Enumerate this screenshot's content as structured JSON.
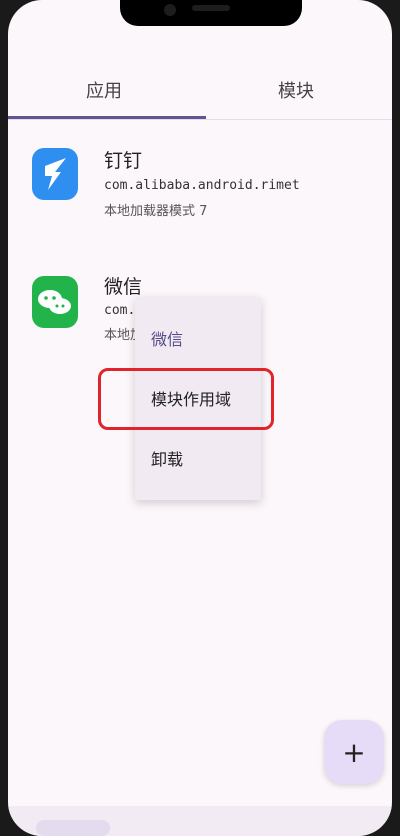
{
  "tabs": [
    {
      "label": "应用"
    },
    {
      "label": "模块"
    }
  ],
  "apps": [
    {
      "name": "钉钉",
      "package": "com.alibaba.android.rimet",
      "meta": "本地加载器模式 7",
      "icon": "dingtalk-icon"
    },
    {
      "name": "微信",
      "package": "com.",
      "meta": "本地加",
      "icon": "wechat-icon"
    }
  ],
  "context_menu": {
    "title": "微信",
    "items": [
      {
        "label": "模块作用域"
      },
      {
        "label": "卸载"
      }
    ]
  },
  "fab": {
    "label": "+"
  },
  "colors": {
    "accent": "#5e5690",
    "highlight": "#e12429",
    "dingtalk": "#2f8ff0",
    "wechat": "#22b44a"
  }
}
